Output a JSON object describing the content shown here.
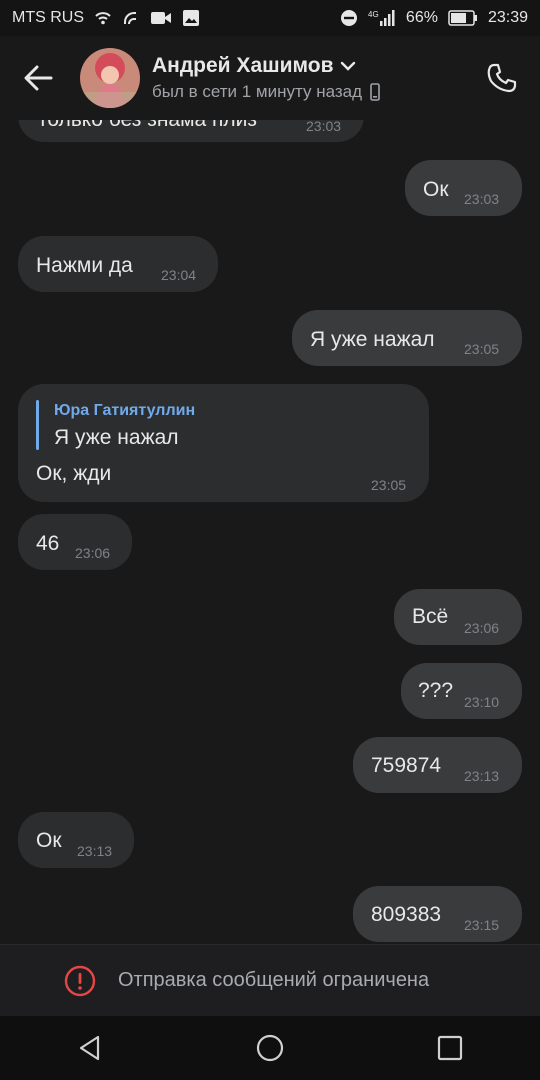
{
  "status_bar": {
    "carrier": "MTS RUS",
    "network": "4G",
    "battery": "66%",
    "time": "23:39"
  },
  "header": {
    "name": "Андрей Хашимов",
    "status": "был в сети 1 минуту назад"
  },
  "messages": [
    {
      "text": "только без знама плиз",
      "time": "23:03",
      "direction": "in"
    },
    {
      "text": "Ок",
      "time": "23:03",
      "direction": "out"
    },
    {
      "text": "Нажми да",
      "time": "23:04",
      "direction": "in"
    },
    {
      "text": "Я уже нажал",
      "time": "23:05",
      "direction": "out"
    },
    {
      "reply_author": "Юра Гатиятуллин",
      "reply_text": "Я уже нажал",
      "text": "Ок, жди",
      "time": "23:05",
      "direction": "in"
    },
    {
      "text": "46",
      "time": "23:06",
      "direction": "in"
    },
    {
      "text": "Всё",
      "time": "23:06",
      "direction": "out"
    },
    {
      "text": "???",
      "time": "23:10",
      "direction": "out"
    },
    {
      "text": "759874",
      "time": "23:13",
      "direction": "out"
    },
    {
      "text": "Ок",
      "time": "23:13",
      "direction": "in"
    },
    {
      "text": "809383",
      "time": "23:15",
      "direction": "out"
    }
  ],
  "restriction": {
    "text": "Отправка сообщений ограничена"
  },
  "colors": {
    "background": "#19191a",
    "bubble_in": "#2c2d2f",
    "bubble_out": "#3a3b3d",
    "accent": "#71aaeb",
    "warning": "#e64646"
  },
  "icons": [
    "back-arrow-icon",
    "chevron-down-icon",
    "phone-icon",
    "mobile-device-icon",
    "alert-icon",
    "nav-back-icon",
    "nav-home-icon",
    "nav-recents-icon"
  ]
}
